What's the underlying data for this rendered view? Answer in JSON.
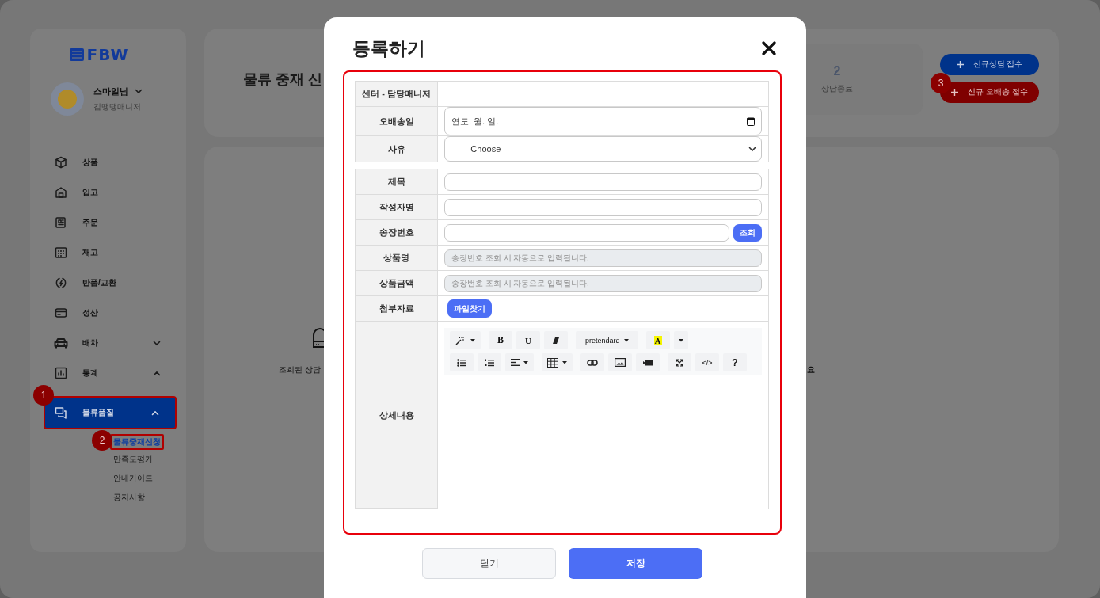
{
  "sidebar": {
    "logo": "FBW",
    "user": {
      "name": "스마일님",
      "role": "김땡땡매니저"
    },
    "menu": [
      {
        "label": "상품",
        "kind": "link",
        "selected": false
      },
      {
        "label": "입고",
        "kind": "link",
        "selected": false
      },
      {
        "label": "주문",
        "kind": "link",
        "selected": false
      },
      {
        "label": "재고",
        "kind": "link",
        "selected": false
      },
      {
        "label": "반품/교환",
        "kind": "link",
        "selected": false
      },
      {
        "label": "정산",
        "kind": "link",
        "selected": false
      },
      {
        "label": "배차",
        "kind": "group",
        "expanded": false,
        "selected": false
      },
      {
        "label": "통계",
        "kind": "group",
        "expanded": true,
        "selected": false
      },
      {
        "label": "물류품질",
        "kind": "group",
        "expanded": true,
        "selected": true,
        "callout": "1",
        "children": [
          {
            "label": "물류중재신청",
            "selected": true,
            "callout": "2"
          },
          {
            "label": "만족도평가",
            "selected": false
          },
          {
            "label": "안내가이드",
            "selected": false
          },
          {
            "label": "공지사항",
            "selected": false
          }
        ]
      }
    ]
  },
  "header": {
    "title": "물류 중재 신",
    "stats": [
      {
        "value": "2",
        "label": "상담종료"
      }
    ],
    "actions": [
      {
        "label": "신규상담 접수",
        "kind": "primary"
      },
      {
        "label": "신규 오배송 접수",
        "kind": "danger",
        "callout": "3"
      }
    ]
  },
  "content": {
    "message_left": "조회된 상담",
    "message_right": "요"
  },
  "modal": {
    "title": "등록하기",
    "sections": [
      [
        {
          "label": "센터 - 담당매니저",
          "kind": "text"
        },
        {
          "label": "오배송일",
          "kind": "date",
          "value": "연도. 월. 일."
        },
        {
          "label": "사유",
          "kind": "select",
          "value": "----- Choose -----"
        }
      ],
      [
        {
          "label": "제목",
          "kind": "input"
        },
        {
          "label": "작성자명",
          "kind": "input"
        },
        {
          "label": "송장번호",
          "kind": "lookup",
          "button": "조회"
        },
        {
          "label": "상품명",
          "kind": "readonly",
          "placeholder": "송장번호 조회 시 자동으로 입력됩니다."
        },
        {
          "label": "상품금액",
          "kind": "readonly",
          "placeholder": "송장번호 조회 시 자동으로 입력됩니다."
        },
        {
          "label": "첨부자료",
          "kind": "file",
          "button": "파일찾기"
        },
        {
          "label": "상세내용",
          "kind": "editor",
          "toolbar": [
            [
              [
                {
                  "kind": "wand"
                }
              ],
              [
                {
                  "kind": "bold",
                  "label": "B"
                },
                {
                  "kind": "underline",
                  "label": "U"
                },
                {
                  "kind": "eraser"
                }
              ],
              [
                {
                  "kind": "font",
                  "label": "pretendard"
                }
              ],
              [
                {
                  "kind": "highlight",
                  "label": "A"
                },
                {
                  "kind": "caret"
                }
              ]
            ],
            [
              [
                {
                  "kind": "bullets"
                },
                {
                  "kind": "numbers"
                },
                {
                  "kind": "align"
                }
              ],
              [
                {
                  "kind": "table"
                }
              ],
              [
                {
                  "kind": "link"
                },
                {
                  "kind": "image"
                },
                {
                  "kind": "video"
                }
              ],
              [
                {
                  "kind": "fullscreen"
                },
                {
                  "kind": "code",
                  "label": "</>"
                },
                {
                  "kind": "help",
                  "label": "?"
                }
              ]
            ]
          ]
        }
      ]
    ],
    "buttons": [
      {
        "label": "닫기",
        "kind": "secondary"
      },
      {
        "label": "저장",
        "kind": "primary"
      }
    ]
  }
}
